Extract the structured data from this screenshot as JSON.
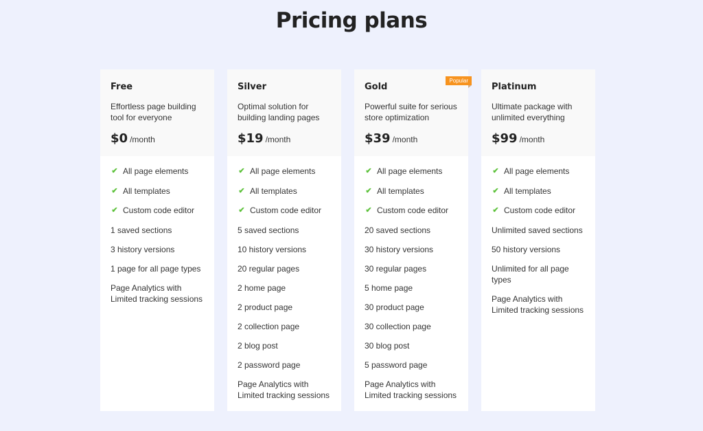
{
  "header": {
    "title": "Pricing plans"
  },
  "colors": {
    "background": "#eef1fd",
    "card": "#ffffff",
    "card_header": "#f9f9f9",
    "check": "#5cc13a",
    "badge": "#f7931e"
  },
  "plans": [
    {
      "name": "Free",
      "description": "Effortless page building tool for everyone",
      "price": "$0",
      "period": "/month",
      "badge": null,
      "features": [
        {
          "text": "All page elements",
          "icon": "check-icon"
        },
        {
          "text": "All templates",
          "icon": "check-icon"
        },
        {
          "text": "Custom code editor",
          "icon": "check-icon"
        },
        {
          "text": "1 saved sections",
          "icon": null
        },
        {
          "text": "3 history versions",
          "icon": null
        },
        {
          "text": "1 page for all page types",
          "icon": null
        },
        {
          "text": "Page Analytics with Limited tracking sessions",
          "icon": null
        }
      ]
    },
    {
      "name": "Silver",
      "description": "Optimal solution for building landing pages",
      "price": "$19",
      "period": "/month",
      "badge": null,
      "features": [
        {
          "text": "All page elements",
          "icon": "check-icon"
        },
        {
          "text": "All templates",
          "icon": "check-icon"
        },
        {
          "text": "Custom code editor",
          "icon": "check-icon"
        },
        {
          "text": "5 saved sections",
          "icon": null
        },
        {
          "text": "10 history versions",
          "icon": null
        },
        {
          "text": "20 regular pages",
          "icon": null
        },
        {
          "text": "2 home page",
          "icon": null
        },
        {
          "text": "2 product page",
          "icon": null
        },
        {
          "text": "2 collection page",
          "icon": null
        },
        {
          "text": "2 blog post",
          "icon": null
        },
        {
          "text": "2 password page",
          "icon": null
        },
        {
          "text": "Page Analytics with Limited tracking sessions",
          "icon": null
        }
      ]
    },
    {
      "name": "Gold",
      "description": "Powerful suite for serious store optimization",
      "price": "$39",
      "period": "/month",
      "badge": "Popular",
      "features": [
        {
          "text": "All page elements",
          "icon": "check-icon"
        },
        {
          "text": "All templates",
          "icon": "check-icon"
        },
        {
          "text": "Custom code editor",
          "icon": "check-icon"
        },
        {
          "text": "20 saved sections",
          "icon": null
        },
        {
          "text": "30 history versions",
          "icon": null
        },
        {
          "text": "30 regular pages",
          "icon": null
        },
        {
          "text": "5 home page",
          "icon": null
        },
        {
          "text": "30 product page",
          "icon": null
        },
        {
          "text": "30 collection page",
          "icon": null
        },
        {
          "text": "30 blog post",
          "icon": null
        },
        {
          "text": "5 password page",
          "icon": null
        },
        {
          "text": "Page Analytics with Limited tracking sessions",
          "icon": null
        }
      ]
    },
    {
      "name": "Platinum",
      "description": "Ultimate package with unlimited everything",
      "price": "$99",
      "period": "/month",
      "badge": null,
      "features": [
        {
          "text": "All page elements",
          "icon": "check-icon"
        },
        {
          "text": "All templates",
          "icon": "check-icon"
        },
        {
          "text": "Custom code editor",
          "icon": "check-icon"
        },
        {
          "text": "Unlimited saved sections",
          "icon": null
        },
        {
          "text": "50 history versions",
          "icon": null
        },
        {
          "text": "Unlimited for all page types",
          "icon": null
        },
        {
          "text": "Page Analytics with Limited tracking sessions",
          "icon": null
        }
      ]
    }
  ]
}
